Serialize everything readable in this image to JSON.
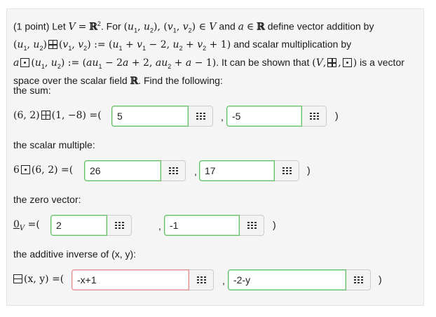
{
  "problem": {
    "points": "(1 point)",
    "intro_1": "Let",
    "intro_2": ". For",
    "intro_3": "and",
    "intro_4": "define vector addition by",
    "and_scalar": "and scalar multiplication by",
    "shown": ". It can be shown that",
    "is_a_vector": "is a vector",
    "space_over": "space over the scalar field",
    "find": ". Find the following:"
  },
  "sections": {
    "sum": {
      "label": "the sum:",
      "lhs_a": "(6, 2)",
      "lhs_b": "(1, −8) =(",
      "input1": "5",
      "input2": "-5"
    },
    "scalar": {
      "label": "the scalar multiple:",
      "lhs_a": "6",
      "lhs_b": "(6, 2) =(",
      "input1": "26",
      "input2": "17"
    },
    "zero": {
      "label": "the zero vector:",
      "lhs": "0",
      "lhs_sub": "V",
      "lhs_tail": " =(",
      "input1": "2",
      "input2": "-1"
    },
    "inverse": {
      "label": "the additive inverse of (x, y):",
      "lhs": "(x, y) =(",
      "input1": "-x+1",
      "input2": "-2-y"
    }
  },
  "punct": {
    "comma": ",",
    "close": ")"
  },
  "colors": {
    "correct": "#5fbf62",
    "incorrect": "#e58b8b"
  },
  "icons": {
    "keyboard": "grid-keypad-icon"
  }
}
